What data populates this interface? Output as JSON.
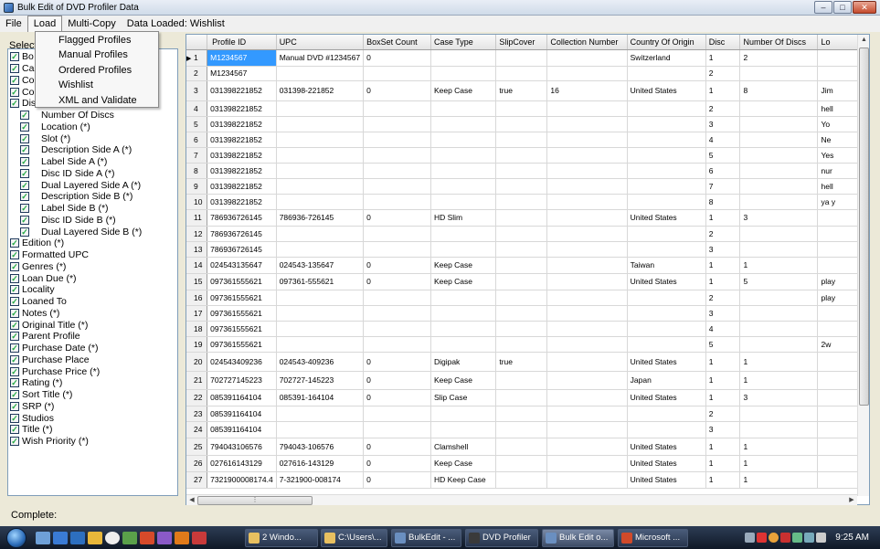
{
  "window": {
    "title": "Bulk Edit of DVD Profiler Data"
  },
  "menu": {
    "file": "File",
    "load": "Load",
    "multi_copy": "Multi-Copy",
    "status": "Data Loaded: Wishlist"
  },
  "load_menu": [
    "Flagged Profiles",
    "Manual Profiles",
    "Ordered Profiles",
    "Wishlist",
    "XML and Validate"
  ],
  "left_panel": {
    "label": "Select",
    "fields": [
      {
        "label": "Bo",
        "indent": 0
      },
      {
        "label": "Ca",
        "indent": 0
      },
      {
        "label": "Co",
        "indent": 0
      },
      {
        "label": "Co",
        "indent": 0
      },
      {
        "label": "Dis",
        "indent": 0
      },
      {
        "label": "Number Of Discs",
        "indent": 1
      },
      {
        "label": "Location (*)",
        "indent": 1
      },
      {
        "label": "Slot (*)",
        "indent": 1
      },
      {
        "label": "Description Side A (*)",
        "indent": 1
      },
      {
        "label": "Label Side A (*)",
        "indent": 1
      },
      {
        "label": "Disc ID Side A (*)",
        "indent": 1
      },
      {
        "label": "Dual Layered Side A (*)",
        "indent": 1
      },
      {
        "label": "Description Side B (*)",
        "indent": 1
      },
      {
        "label": "Label Side B (*)",
        "indent": 1
      },
      {
        "label": "Disc ID Side B (*)",
        "indent": 1
      },
      {
        "label": "Dual Layered Side B (*)",
        "indent": 1
      },
      {
        "label": "Edition (*)",
        "indent": 0
      },
      {
        "label": "Formatted UPC",
        "indent": 0
      },
      {
        "label": "Genres (*)",
        "indent": 0
      },
      {
        "label": "Loan Due (*)",
        "indent": 0
      },
      {
        "label": "Locality",
        "indent": 0
      },
      {
        "label": "Loaned To",
        "indent": 0
      },
      {
        "label": "Notes (*)",
        "indent": 0
      },
      {
        "label": "Original Title (*)",
        "indent": 0
      },
      {
        "label": "Parent Profile",
        "indent": 0
      },
      {
        "label": "Purchase Date (*)",
        "indent": 0
      },
      {
        "label": "Purchase Place",
        "indent": 0
      },
      {
        "label": "Purchase Price (*)",
        "indent": 0
      },
      {
        "label": "Rating (*)",
        "indent": 0
      },
      {
        "label": "Sort Title (*)",
        "indent": 0
      },
      {
        "label": "SRP (*)",
        "indent": 0
      },
      {
        "label": "Studios",
        "indent": 0
      },
      {
        "label": "Title (*)",
        "indent": 0
      },
      {
        "label": "Wish Priority (*)",
        "indent": 0
      }
    ]
  },
  "grid": {
    "columns": [
      "Profile ID",
      "UPC",
      "BoxSet Count",
      "Case Type",
      "SlipCover",
      "Collection Number",
      "Country Of Origin",
      "Disc",
      "Number Of Discs",
      "Lo"
    ],
    "rows": [
      [
        "1",
        "M1234567",
        "Manual DVD #1234567",
        "0",
        "",
        "",
        "",
        "Switzerland",
        "1",
        "2",
        ""
      ],
      [
        "2",
        "M1234567",
        "",
        "",
        "",
        "",
        "",
        "",
        "2",
        "",
        ""
      ],
      [
        "3",
        "031398221852",
        "031398-221852",
        "0",
        "Keep Case",
        "true",
        "16",
        "United States",
        "1",
        "8",
        "Jim"
      ],
      [
        "4",
        "031398221852",
        "",
        "",
        "",
        "",
        "",
        "",
        "2",
        "",
        "hell"
      ],
      [
        "5",
        "031398221852",
        "",
        "",
        "",
        "",
        "",
        "",
        "3",
        "",
        "Yo"
      ],
      [
        "6",
        "031398221852",
        "",
        "",
        "",
        "",
        "",
        "",
        "4",
        "",
        "Ne"
      ],
      [
        "7",
        "031398221852",
        "",
        "",
        "",
        "",
        "",
        "",
        "5",
        "",
        "Yes"
      ],
      [
        "8",
        "031398221852",
        "",
        "",
        "",
        "",
        "",
        "",
        "6",
        "",
        "nur"
      ],
      [
        "9",
        "031398221852",
        "",
        "",
        "",
        "",
        "",
        "",
        "7",
        "",
        "hell"
      ],
      [
        "10",
        "031398221852",
        "",
        "",
        "",
        "",
        "",
        "",
        "8",
        "",
        "ya y"
      ],
      [
        "11",
        "786936726145",
        "786936-726145",
        "0",
        "HD Slim",
        "",
        "",
        "United States",
        "1",
        "3",
        ""
      ],
      [
        "12",
        "786936726145",
        "",
        "",
        "",
        "",
        "",
        "",
        "2",
        "",
        ""
      ],
      [
        "13",
        "786936726145",
        "",
        "",
        "",
        "",
        "",
        "",
        "3",
        "",
        ""
      ],
      [
        "14",
        "024543135647",
        "024543-135647",
        "0",
        "Keep Case",
        "",
        "",
        "Taiwan",
        "1",
        "1",
        ""
      ],
      [
        "15",
        "097361555621",
        "097361-555621",
        "0",
        "Keep Case",
        "",
        "",
        "United States",
        "1",
        "5",
        "play"
      ],
      [
        "16",
        "097361555621",
        "",
        "",
        "",
        "",
        "",
        "",
        "2",
        "",
        "play"
      ],
      [
        "17",
        "097361555621",
        "",
        "",
        "",
        "",
        "",
        "",
        "3",
        "",
        ""
      ],
      [
        "18",
        "097361555621",
        "",
        "",
        "",
        "",
        "",
        "",
        "4",
        "",
        ""
      ],
      [
        "19",
        "097361555621",
        "",
        "",
        "",
        "",
        "",
        "",
        "5",
        "",
        "2w"
      ],
      [
        "20",
        "024543409236",
        "024543-409236",
        "0",
        "Digipak",
        "true",
        "",
        "United States",
        "1",
        "1",
        ""
      ],
      [
        "21",
        "702727145223",
        "702727-145223",
        "0",
        "Keep Case",
        "",
        "",
        "Japan",
        "1",
        "1",
        ""
      ],
      [
        "22",
        "085391164104",
        "085391-164104",
        "0",
        "Slip Case",
        "",
        "",
        "United States",
        "1",
        "3",
        ""
      ],
      [
        "23",
        "085391164104",
        "",
        "",
        "",
        "",
        "",
        "",
        "2",
        "",
        ""
      ],
      [
        "24",
        "085391164104",
        "",
        "",
        "",
        "",
        "",
        "",
        "3",
        "",
        ""
      ],
      [
        "25",
        "794043106576",
        "794043-106576",
        "0",
        "Clamshell",
        "",
        "",
        "United States",
        "1",
        "1",
        ""
      ],
      [
        "26",
        "027616143129",
        "027616-143129",
        "0",
        "Keep Case",
        "",
        "",
        "United States",
        "1",
        "1",
        ""
      ],
      [
        "27",
        "7321900008174.4",
        "7-321900-008174",
        "0",
        "HD Keep Case",
        "",
        "",
        "United States",
        "1",
        "1",
        ""
      ]
    ]
  },
  "status_bar": {
    "text": "Complete:"
  },
  "taskbar": {
    "tasks": [
      "2 Windo...",
      "C:\\Users\\...",
      "BulkEdit - ...",
      "DVD Profiler",
      "Bulk Edit o...",
      "Microsoft ..."
    ],
    "clock": "9:25 AM"
  }
}
